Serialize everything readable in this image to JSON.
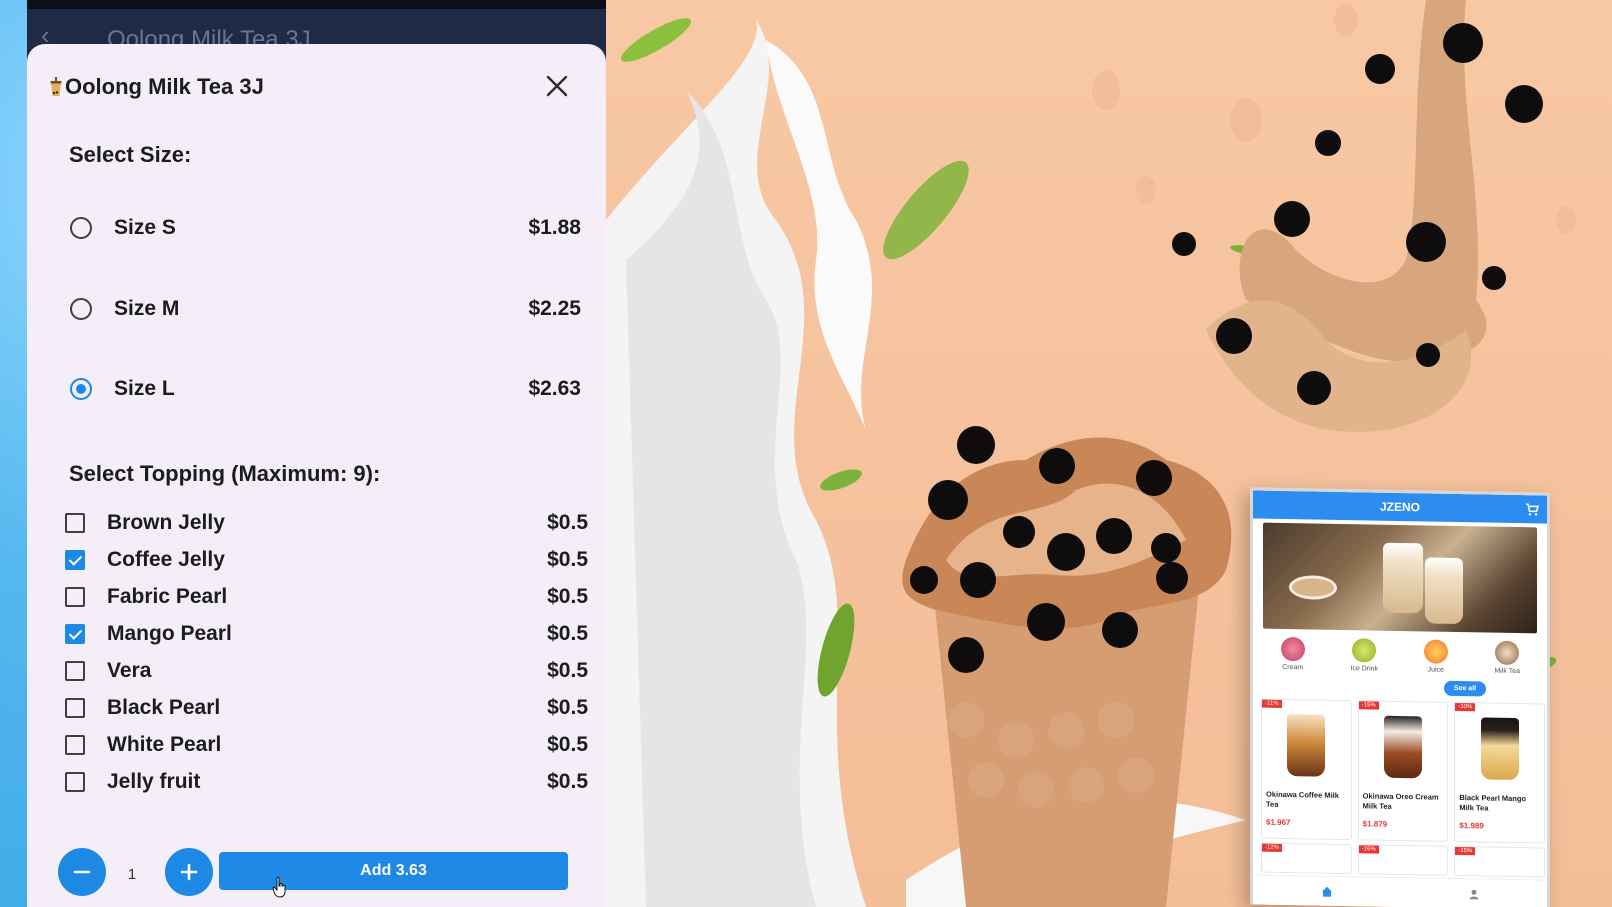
{
  "app": {
    "back_title": "Oolong Milk Tea 3J"
  },
  "dialog": {
    "title": "Oolong Milk Tea 3J",
    "size_section": "Select Size:",
    "sizes": [
      {
        "label": "Size S",
        "price": "$1.88",
        "selected": false
      },
      {
        "label": "Size M",
        "price": "$2.25",
        "selected": false
      },
      {
        "label": "Size L",
        "price": "$2.63",
        "selected": true
      }
    ],
    "topping_section": "Select Topping (Maximum: 9):",
    "toppings": [
      {
        "label": "Brown Jelly",
        "price": "$0.5",
        "checked": false
      },
      {
        "label": "Coffee Jelly",
        "price": "$0.5",
        "checked": true
      },
      {
        "label": "Fabric Pearl",
        "price": "$0.5",
        "checked": false
      },
      {
        "label": "Mango Pearl",
        "price": "$0.5",
        "checked": true
      },
      {
        "label": "Vera",
        "price": "$0.5",
        "checked": false
      },
      {
        "label": "Black Pearl",
        "price": "$0.5",
        "checked": false
      },
      {
        "label": "White Pearl",
        "price": "$0.5",
        "checked": false
      },
      {
        "label": "Jelly fruit",
        "price": "$0.5",
        "checked": false
      }
    ],
    "quantity": "1",
    "add_button": "Add 3.63"
  },
  "mockup": {
    "brand": "JZENO",
    "categories": [
      "Cream",
      "Ice Drink",
      "Juice",
      "Milk Tea"
    ],
    "see_all": "See all",
    "products": [
      {
        "badge": "-11%",
        "name": "Okinawa Coffee Milk Tea",
        "price": "$1.967"
      },
      {
        "badge": "-15%",
        "name": "Okinawa Oreo Cream Milk Tea",
        "price": "$1.879"
      },
      {
        "badge": "-10%",
        "name": "Black Pearl Mango Milk Tea",
        "price": "$1.989"
      }
    ],
    "row2_badges": [
      "-12%",
      "-16%",
      "-15%"
    ]
  },
  "colors": {
    "accent": "#1e88e5",
    "dialog_bg": "#f3eef8",
    "peach_bg": "#f5c19c",
    "sale_red": "#e53935"
  }
}
